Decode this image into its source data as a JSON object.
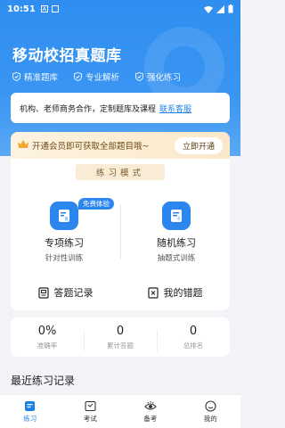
{
  "status": {
    "time": "10:51",
    "mini_label": "A"
  },
  "header": {
    "title": "移动校招真题库",
    "features": [
      "精准题库",
      "专业解析",
      "强化练习"
    ]
  },
  "notice": {
    "text": "机构、老师商务合作，定制题库及课程",
    "link": "联系客服"
  },
  "vip": {
    "text": "开通会员即可获取全部题目哦~",
    "button": "立即开通"
  },
  "section_title": "练习模式",
  "practice": [
    {
      "name": "专项练习",
      "sub": "针对性训练",
      "badge": "免费体验",
      "icon": "book-icon"
    },
    {
      "name": "随机练习",
      "sub": "抽题式训练",
      "icon": "shuffle-icon"
    }
  ],
  "records": [
    {
      "label": "答题记录",
      "icon": "record-icon"
    },
    {
      "label": "我的错题",
      "icon": "wrong-icon"
    }
  ],
  "stats": [
    {
      "value": "0%",
      "label": "准确率"
    },
    {
      "value": "0",
      "label": "累计答题"
    },
    {
      "value": "0",
      "label": "总排名"
    }
  ],
  "recent_title": "最近练习记录",
  "tabs": [
    {
      "label": "练习",
      "icon": "practice-icon",
      "active": true
    },
    {
      "label": "考试",
      "icon": "exam-icon"
    },
    {
      "label": "备考",
      "icon": "eye-icon"
    },
    {
      "label": "我的",
      "icon": "smile-icon"
    }
  ],
  "colors": {
    "primary": "#1d83e6",
    "header": "#3a95f2",
    "vip": "#fbe8c9"
  }
}
